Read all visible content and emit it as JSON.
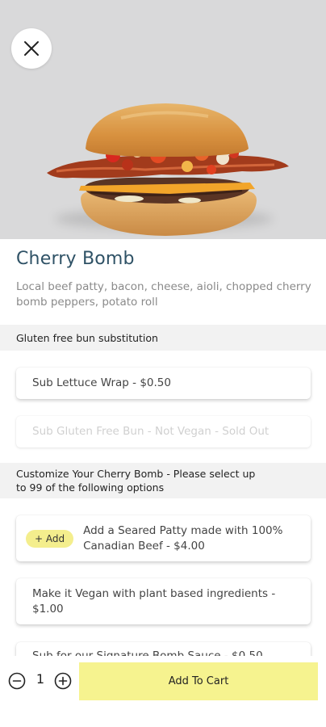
{
  "product": {
    "title": "Cherry Bomb",
    "description": "Local beef patty, bacon, cheese, aioli, chopped cherry bomb peppers, potato roll"
  },
  "sections": [
    {
      "header": "Gluten free bun substitution",
      "options": [
        {
          "label": "Sub Lettuce Wrap - $0.50",
          "disabled": false
        },
        {
          "label": "Sub Gluten Free Bun - Not Vegan - Sold Out",
          "disabled": true
        }
      ]
    },
    {
      "header": "Customize Your Cherry Bomb - Please select up to 99 of the following options",
      "options": [
        {
          "label": "Add a Seared Patty made with 100% Canadian Beef - $4.00",
          "badge": "+ Add"
        },
        {
          "label": "Make it Vegan with plant based ingredients - $1.00"
        },
        {
          "label": "Sub for our Signature Bomb Sauce - $0.50"
        }
      ]
    }
  ],
  "cart": {
    "quantity": "1",
    "add_label": "Add To Cart"
  },
  "colors": {
    "title": "#2f5266",
    "accent": "#f6f38f",
    "pill": "#f4ee8d",
    "section_bg": "#f2f2f2"
  },
  "icons": {
    "close": "close-icon",
    "minus": "minus-circle-icon",
    "plus": "plus-circle-icon"
  }
}
